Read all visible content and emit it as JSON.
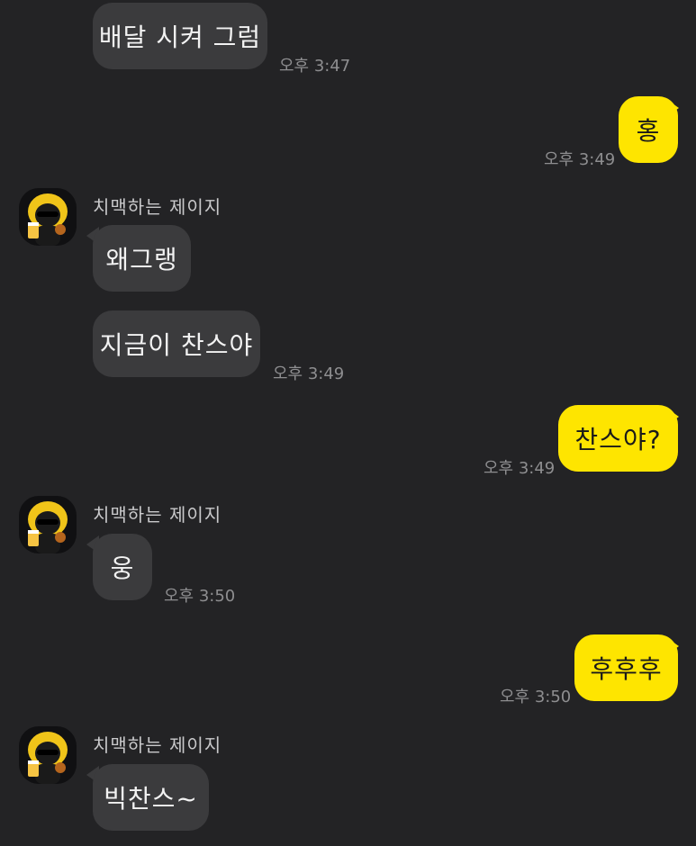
{
  "chat": {
    "messages": [
      {
        "id": "m1",
        "text": "배달 시켜 그럼",
        "time": "오후 3:47"
      },
      {
        "id": "m2",
        "text": "홍",
        "time": "오후 3:49"
      },
      {
        "id": "m3",
        "sender": "치맥하는 제이지",
        "text": "왜그랭"
      },
      {
        "id": "m4",
        "text": "지금이 찬스야",
        "time": "오후 3:49"
      },
      {
        "id": "m5",
        "text": "찬스야?",
        "time": "오후 3:49"
      },
      {
        "id": "m6",
        "sender": "치맥하는 제이지",
        "text": "웅",
        "time": "오후 3:50"
      },
      {
        "id": "m7",
        "text": "후후후",
        "time": "오후 3:50"
      },
      {
        "id": "m8",
        "sender": "치맥하는 제이지",
        "text": "빅찬스~"
      }
    ],
    "colors": {
      "background": "#232325",
      "incoming_bubble": "#3b3b3d",
      "outgoing_bubble": "#fee500",
      "timestamp": "#8e8e90",
      "sender_name": "#c9c9cb"
    },
    "avatar_icon": "jay-g-character-avatar-icon"
  }
}
